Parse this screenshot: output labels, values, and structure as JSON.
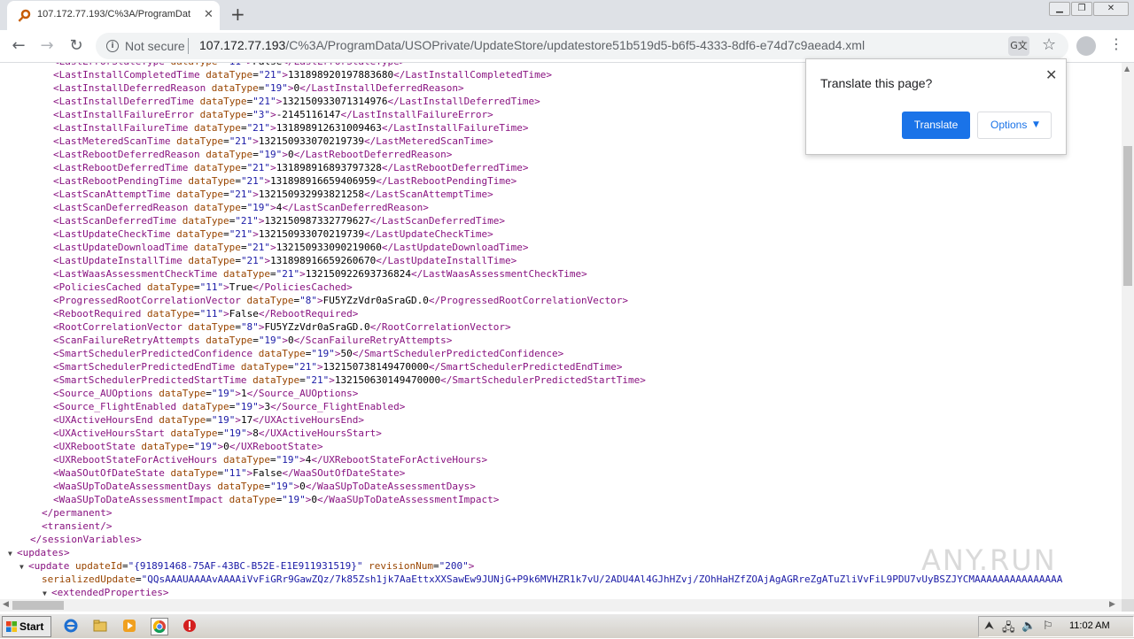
{
  "browser": {
    "tab_title": "107.172.77.193/C%3A/ProgramDat",
    "tab_close": "✕",
    "new_tab": "+",
    "window_controls": {
      "minimize": "▁",
      "restore": "❐",
      "close": "✕"
    },
    "nav": {
      "back": "←",
      "forward": "→",
      "reload": "↻"
    },
    "security_label": "Not secure",
    "url_host": "107.172.77.193",
    "url_path": "/C%3A/ProgramData/USOPrivate/UpdateStore/updatestore51b519d5-b6f5-4333-8df6-e74d7c9aead4.xml",
    "translate_icon": "G文",
    "star_icon": "☆",
    "menu_icon": "⋮"
  },
  "translate_popup": {
    "title": "Translate this page?",
    "close": "✕",
    "translate_label": "Translate",
    "options_label": "Options",
    "options_arrow": "▼"
  },
  "xml_lines": [
    {
      "indent": 4,
      "tag": "LastErrorStateType",
      "type": "11",
      "value": "False",
      "partial": true
    },
    {
      "indent": 4,
      "tag": "LastInstallCompletedTime",
      "type": "21",
      "value": "131898920197883680"
    },
    {
      "indent": 4,
      "tag": "LastInstallDeferredReason",
      "type": "19",
      "value": "0"
    },
    {
      "indent": 4,
      "tag": "LastInstallDeferredTime",
      "type": "21",
      "value": "132150933071314976"
    },
    {
      "indent": 4,
      "tag": "LastInstallFailureError",
      "type": "3",
      "value": "-2145116147"
    },
    {
      "indent": 4,
      "tag": "LastInstallFailureTime",
      "type": "21",
      "value": "131898912631009463"
    },
    {
      "indent": 4,
      "tag": "LastMeteredScanTime",
      "type": "21",
      "value": "132150933070219739"
    },
    {
      "indent": 4,
      "tag": "LastRebootDeferredReason",
      "type": "19",
      "value": "0"
    },
    {
      "indent": 4,
      "tag": "LastRebootDeferredTime",
      "type": "21",
      "value": "131898916893797328"
    },
    {
      "indent": 4,
      "tag": "LastRebootPendingTime",
      "type": "21",
      "value": "131898916659406959"
    },
    {
      "indent": 4,
      "tag": "LastScanAttemptTime",
      "type": "21",
      "value": "132150932993821258"
    },
    {
      "indent": 4,
      "tag": "LastScanDeferredReason",
      "type": "19",
      "value": "4"
    },
    {
      "indent": 4,
      "tag": "LastScanDeferredTime",
      "type": "21",
      "value": "132150987332779627"
    },
    {
      "indent": 4,
      "tag": "LastUpdateCheckTime",
      "type": "21",
      "value": "132150933070219739"
    },
    {
      "indent": 4,
      "tag": "LastUpdateDownloadTime",
      "type": "21",
      "value": "132150933090219060"
    },
    {
      "indent": 4,
      "tag": "LastUpdateInstallTime",
      "type": "21",
      "value": "131898916659260670"
    },
    {
      "indent": 4,
      "tag": "LastWaasAssessmentCheckTime",
      "type": "21",
      "value": "132150922693736824"
    },
    {
      "indent": 4,
      "tag": "PoliciesCached",
      "type": "11",
      "value": "True"
    },
    {
      "indent": 4,
      "tag": "ProgressedRootCorrelationVector",
      "type": "8",
      "value": "FU5YZzVdr0aSraGD.0"
    },
    {
      "indent": 4,
      "tag": "RebootRequired",
      "type": "11",
      "value": "False"
    },
    {
      "indent": 4,
      "tag": "RootCorrelationVector",
      "type": "8",
      "value": "FU5YZzVdr0aSraGD.0"
    },
    {
      "indent": 4,
      "tag": "ScanFailureRetryAttempts",
      "type": "19",
      "value": "0"
    },
    {
      "indent": 4,
      "tag": "SmartSchedulerPredictedConfidence",
      "type": "19",
      "value": "50"
    },
    {
      "indent": 4,
      "tag": "SmartSchedulerPredictedEndTime",
      "type": "21",
      "value": "132150738149470000"
    },
    {
      "indent": 4,
      "tag": "SmartSchedulerPredictedStartTime",
      "type": "21",
      "value": "132150630149470000"
    },
    {
      "indent": 4,
      "tag": "Source_AUOptions",
      "type": "19",
      "value": "1"
    },
    {
      "indent": 4,
      "tag": "Source_FlightEnabled",
      "type": "19",
      "value": "3"
    },
    {
      "indent": 4,
      "tag": "UXActiveHoursEnd",
      "type": "19",
      "value": "17"
    },
    {
      "indent": 4,
      "tag": "UXActiveHoursStart",
      "type": "19",
      "value": "8"
    },
    {
      "indent": 4,
      "tag": "UXRebootState",
      "type": "19",
      "value": "0"
    },
    {
      "indent": 4,
      "tag": "UXRebootStateForActiveHours",
      "type": "19",
      "value": "4"
    },
    {
      "indent": 4,
      "tag": "WaaSOutOfDateState",
      "type": "11",
      "value": "False"
    },
    {
      "indent": 4,
      "tag": "WaaSUpToDateAssessmentDays",
      "type": "19",
      "value": "0"
    },
    {
      "indent": 4,
      "tag": "WaaSUpToDateAssessmentImpact",
      "type": "19",
      "value": "0"
    },
    {
      "indent": 3,
      "raw": "</permanent>"
    },
    {
      "indent": 3,
      "raw": "<transient/>"
    },
    {
      "indent": 2,
      "raw": "</sessionVariables>"
    },
    {
      "indent": 1,
      "fold": "▼",
      "raw": "<updates>"
    },
    {
      "indent": 2,
      "fold": "▼",
      "open_tag": "update",
      "attrs": [
        [
          "updateId",
          "{91891468-75AF-43BC-B52E-E1E911931519}"
        ],
        [
          "revisionNum",
          "200"
        ]
      ]
    },
    {
      "indent": 3,
      "attr_only": [
        "serializedUpdate",
        "QQsAAAUAAAAvAAAAiVvFiGRr9GawZQz/7k85Zsh1jk7AaEttxXXSawEw9JUNjG+P9k6MVHZR1k7vU/2ADU4Al4GJhHZvj/ZOhHaHZfZOAjAgAGRreZgATuZliVvFiL9PDU7vUyBSZJYCMAAAAAAAAAAAAAAA"
      ]
    },
    {
      "indent": 4,
      "fold": "▼",
      "raw": "<extendedProperties>"
    }
  ],
  "watermark": "ANY.RUN",
  "taskbar": {
    "start_label": "Start",
    "clock": "11:02 AM"
  }
}
